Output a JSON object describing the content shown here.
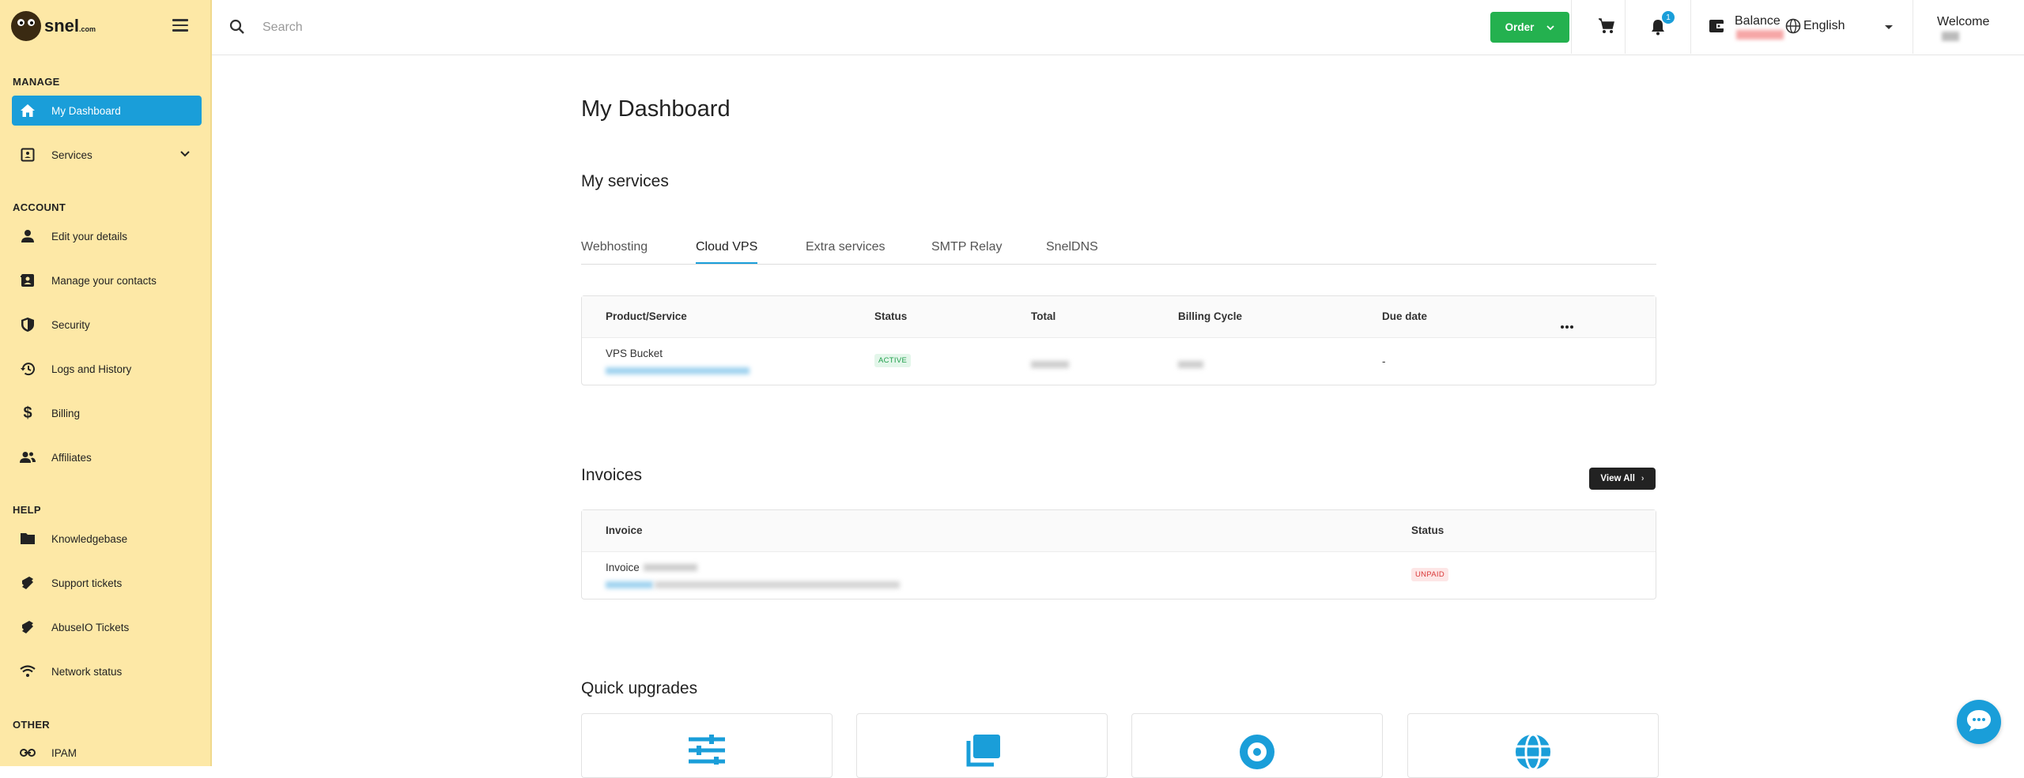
{
  "brand": {
    "name": "snel",
    "suffix": ".com"
  },
  "sidebar": {
    "sections": [
      {
        "title": "MANAGE"
      },
      {
        "title": "ACCOUNT"
      },
      {
        "title": "HELP"
      },
      {
        "title": "OTHER"
      }
    ],
    "items": [
      {
        "label": "My Dashboard",
        "icon": "home-icon",
        "active": true
      },
      {
        "label": "Services",
        "icon": "services-icon",
        "expandable": true
      },
      {
        "label": "Edit your details",
        "icon": "person-icon"
      },
      {
        "label": "Manage your contacts",
        "icon": "contacts-icon"
      },
      {
        "label": "Security",
        "icon": "shield-icon"
      },
      {
        "label": "Logs and History",
        "icon": "history-icon"
      },
      {
        "label": "Billing",
        "icon": "dollar-icon"
      },
      {
        "label": "Affiliates",
        "icon": "affiliates-icon"
      },
      {
        "label": "Knowledgebase",
        "icon": "folder-icon"
      },
      {
        "label": "Support tickets",
        "icon": "ticket-icon"
      },
      {
        "label": "AbuseIO Tickets",
        "icon": "ticket-icon"
      },
      {
        "label": "Network status",
        "icon": "wifi-icon"
      },
      {
        "label": "IPAM",
        "icon": "link-icon"
      }
    ]
  },
  "topbar": {
    "search_placeholder": "Search",
    "order_label": "Order",
    "notification_count": "1",
    "balance_label": "Balance",
    "language": "English",
    "welcome_label": "Welcome"
  },
  "main": {
    "page_title": "My Dashboard",
    "services_title": "My services",
    "tabs": [
      {
        "label": "Webhosting"
      },
      {
        "label": "Cloud VPS",
        "active": true
      },
      {
        "label": "Extra services"
      },
      {
        "label": "SMTP Relay"
      },
      {
        "label": "SnelDNS"
      }
    ],
    "services_table": {
      "headers": [
        "Product/Service",
        "Status",
        "Total",
        "Billing Cycle",
        "Due date"
      ],
      "rows": [
        {
          "product": "VPS Bucket",
          "status": "ACTIVE",
          "due_date": "-"
        }
      ]
    },
    "invoices_title": "Invoices",
    "view_all_label": "View All",
    "invoices_table": {
      "headers": [
        "Invoice",
        "Status"
      ],
      "rows": [
        {
          "invoice": "Invoice",
          "status": "UNPAID"
        }
      ]
    },
    "quick_upgrades_title": "Quick upgrades",
    "upgrades": [
      {
        "icon": "sliders-icon"
      },
      {
        "icon": "copy-icon"
      },
      {
        "icon": "disc-icon"
      },
      {
        "icon": "globe-icon"
      }
    ]
  },
  "colors": {
    "sidebar_bg": "#fde8a6",
    "accent": "#1a9ed9",
    "order_green": "#24b14f",
    "active_green": "#1e9e4a",
    "unpaid_red": "#d93737"
  }
}
